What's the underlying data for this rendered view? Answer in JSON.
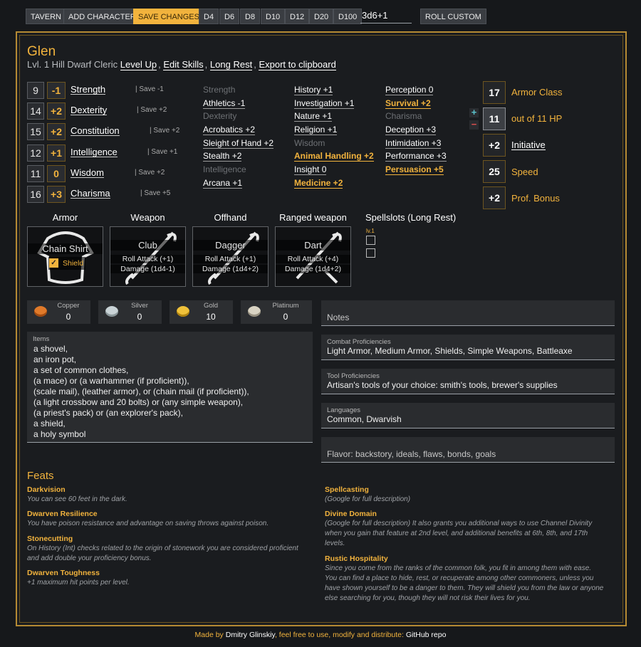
{
  "toolbar": {
    "tavern": "TAVERN",
    "add": "ADD CHARACTER",
    "save": "SAVE CHANGES",
    "d4": "D4",
    "d6": "D6",
    "d8": "D8",
    "d10": "D10",
    "d12": "D12",
    "d20": "D20",
    "d100": "D100",
    "dice_value": "3d6+1",
    "roll": "ROLL CUSTOM"
  },
  "character": {
    "name": "Glen",
    "desc": "Lvl. 1 Hill Dwarf Cleric ",
    "level_up": "Level Up",
    "edit_skills": "Edit Skills",
    "long_rest": "Long Rest",
    "export": "Export to clipboard",
    "sep": ","
  },
  "abilities": [
    {
      "score": "9",
      "mod": "-1",
      "name": "Strength",
      "save": "Save -1"
    },
    {
      "score": "14",
      "mod": "+2",
      "name": "Dexterity",
      "save": "Save +2"
    },
    {
      "score": "15",
      "mod": "+2",
      "name": "Constitution",
      "save": "Save +2"
    },
    {
      "score": "12",
      "mod": "+1",
      "name": "Intelligence",
      "save": "Save +1"
    },
    {
      "score": "11",
      "mod": "0",
      "name": "Wisdom",
      "save": "Save +2"
    },
    {
      "score": "16",
      "mod": "+3",
      "name": "Charisma",
      "save": "Save +5"
    }
  ],
  "skills": {
    "col1": [
      "Strength",
      "Athletics -1",
      "Dexterity",
      "Acrobatics +2",
      "Sleight of Hand +2",
      "Stealth +2",
      "Intelligence",
      "Arcana +1"
    ],
    "col2": [
      "History +1",
      "Investigation +1",
      "Nature +1",
      "Religion +1",
      "Wisdom",
      "Animal Handling +2",
      "Insight 0",
      "Medicine +2"
    ],
    "col3": [
      "Perception 0",
      "Survival +2",
      "Charisma",
      "Deception +3",
      "Intimidation +3",
      "Performance +3",
      "Persuasion +5"
    ]
  },
  "stats": [
    {
      "value": "17",
      "label": "Armor Class"
    },
    {
      "value": "11",
      "label": "out of 11 HP"
    },
    {
      "value": "+2",
      "label": "Initiative"
    },
    {
      "value": "25",
      "label": "Speed"
    },
    {
      "value": "+2",
      "label": "Prof. Bonus"
    }
  ],
  "hp_controls": {
    "plus": "+",
    "minus": "−"
  },
  "equipment": {
    "armor": {
      "header": "Armor",
      "name": "Chain Shirt",
      "shield_label": "Shield"
    },
    "weapon": {
      "header": "Weapon",
      "name": "Club",
      "attack": "Roll Attack (+1)",
      "damage": "Damage (1d4-1)"
    },
    "offhand": {
      "header": "Offhand",
      "name": "Dagger",
      "attack": "Roll Attack (+1)",
      "damage": "Damage (1d4+2)"
    },
    "ranged": {
      "header": "Ranged weapon",
      "name": "Dart",
      "attack": "Roll Attack (+4)",
      "damage": "Damage (1d4+2)"
    },
    "spellslots": {
      "header": "Spellslots (Long Rest)",
      "level": "lv.1"
    }
  },
  "coins": [
    {
      "name": "Copper",
      "value": "0",
      "color": "#e07a2a"
    },
    {
      "name": "Silver",
      "value": "0",
      "color": "#c9d3d6"
    },
    {
      "name": "Gold",
      "value": "10",
      "color": "#f0c23a"
    },
    {
      "name": "Platinum",
      "value": "0",
      "color": "#d8d2c2"
    }
  ],
  "items": {
    "label": "Items",
    "lines": [
      "a shovel,",
      "an iron pot,",
      "a set of common clothes,",
      "(a mace) or (a warhammer (if proficient)),",
      "(scale mail), (leather armor), or (chain mail (if proficient)),",
      "(a light crossbow and 20 bolts) or (any simple weapon),",
      "(a priest's pack) or (an explorer's pack),",
      "a shield,",
      "a holy symbol"
    ]
  },
  "notes": {
    "label": "Notes"
  },
  "combat": {
    "label": "Combat Proficiencies",
    "value": "Light Armor, Medium Armor, Shields, Simple Weapons, Battleaxe"
  },
  "tools": {
    "label": "Tool Proficiencies",
    "value": "Artisan's tools of your choice: smith's tools, brewer's supplies"
  },
  "languages": {
    "label": "Languages",
    "value": "Common, Dwarvish"
  },
  "flavor": {
    "label": "Flavor: backstory, ideals, flaws, bonds, goals"
  },
  "feats": {
    "title": "Feats",
    "left": [
      {
        "name": "Darkvision",
        "desc": [
          "You can see 60 feet in the dark."
        ]
      },
      {
        "name": "Dwarven Resilience",
        "desc": [
          "You have poison resistance and advantage on saving throws against poison."
        ]
      },
      {
        "name": "Stonecutting",
        "desc": [
          "On History (Int) checks related to the origin of stonework you are considered proficient",
          "and add double your proficiency bonus."
        ]
      },
      {
        "name": "Dwarven Toughness",
        "desc": [
          "+1 maximum hit points per level."
        ]
      }
    ],
    "right": [
      {
        "name": "Spellcasting",
        "desc": [
          "(Google for full description)"
        ]
      },
      {
        "name": "Divine Domain",
        "desc": [
          "(Google for full description) It also grants you additional ways to use Channel Divinity",
          "when you gain that feature at 2nd level, and additional benefits at 6th, 8th, and 17th",
          "levels."
        ]
      },
      {
        "name": "Rustic Hospitality",
        "desc": [
          "Since you come from the ranks of the common folk, you fit in among them with ease.",
          "You can find a place to hide, rest, or recuperate among other commoners, unless you",
          "have shown yourself to be a danger to them. They will shield you from the law or anyone",
          "else searching for you, though they will not risk their lives for you."
        ]
      }
    ]
  },
  "footer": {
    "made_by": "Made by ",
    "author": "Dmitry Glinskiy",
    "rest": ", feel free to use, modify and distribute: ",
    "repo": "GitHub repo"
  }
}
